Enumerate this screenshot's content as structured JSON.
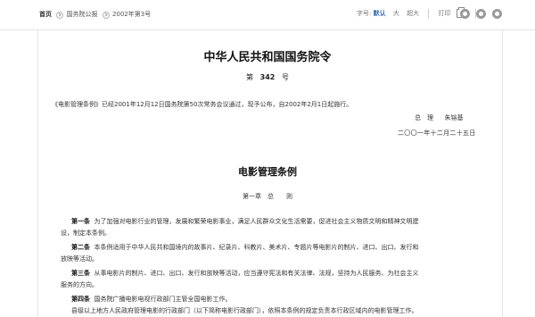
{
  "toolbar": {
    "breadcrumb": [
      "首页",
      "国务院公报",
      "2002年第3号"
    ],
    "font_size_label": "字号:",
    "font_default": "默认",
    "font_small": "大",
    "font_large": "超大",
    "print_label": "打印",
    "share_icons": [
      "weibo-icon",
      "wechat-icon",
      "qq-icon"
    ]
  },
  "document": {
    "order_title": "中华人民共和国国务院令",
    "order_prefix": "第",
    "order_number": "342",
    "order_suffix": "号",
    "intro": "《电影管理条例》已经2001年12月12日国务院第50次常务会议通过，现予公布，自2002年2月1日起施行。",
    "signer_title": "总　理",
    "signer_name": "朱镕基",
    "date": "二〇〇一年十二月二十五日",
    "regulation_title": "电影管理条例",
    "chapter": "第一章　总　　则",
    "articles": [
      {
        "label": "第一条",
        "text": "为了加强对电影行业的管理，发展和繁荣电影事业，满足人民群众文化生活需要，促进社会主义物质文明和精神文明建",
        "cont": "设，制定本条例。"
      },
      {
        "label": "第二条",
        "text": "本条例适用于中华人民共和国境内的故事片、纪录片、科教片、美术片、专题片等电影片的制片、进口、出口、发行和",
        "cont": "放映等活动。"
      },
      {
        "label": "第三条",
        "text": "从事电影片的制片、进口、出口、发行和放映等活动，应当遵守宪法和有关法律、法规，坚持为人民服务、为社会主义",
        "cont": "服务的方向。"
      },
      {
        "label": "第四条",
        "text": "国务院广播电影电视行政部门主管全国电影工作。",
        "cont": "县级以上地方人民政府管理电影的行政部门（以下简称电影行政部门），依照本条例的规定负责本行政区域内的电影管理工作。"
      }
    ]
  }
}
